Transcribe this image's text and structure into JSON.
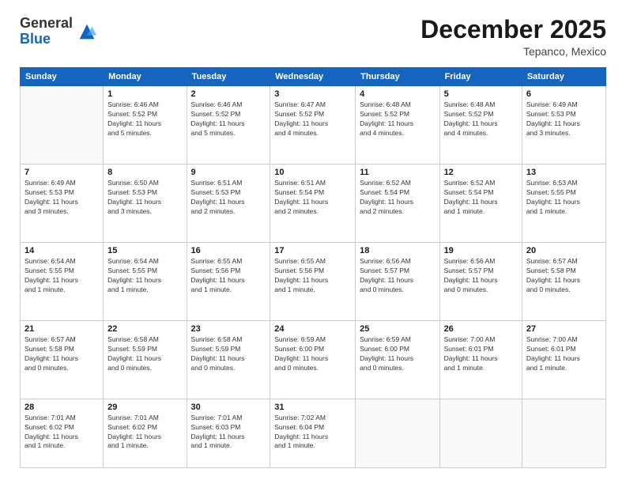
{
  "header": {
    "logo_general": "General",
    "logo_blue": "Blue",
    "month_title": "December 2025",
    "subtitle": "Tepanco, Mexico"
  },
  "calendar": {
    "days_of_week": [
      "Sunday",
      "Monday",
      "Tuesday",
      "Wednesday",
      "Thursday",
      "Friday",
      "Saturday"
    ],
    "weeks": [
      [
        {
          "num": "",
          "info": ""
        },
        {
          "num": "1",
          "info": "Sunrise: 6:46 AM\nSunset: 5:52 PM\nDaylight: 11 hours\nand 5 minutes."
        },
        {
          "num": "2",
          "info": "Sunrise: 6:46 AM\nSunset: 5:52 PM\nDaylight: 11 hours\nand 5 minutes."
        },
        {
          "num": "3",
          "info": "Sunrise: 6:47 AM\nSunset: 5:52 PM\nDaylight: 11 hours\nand 4 minutes."
        },
        {
          "num": "4",
          "info": "Sunrise: 6:48 AM\nSunset: 5:52 PM\nDaylight: 11 hours\nand 4 minutes."
        },
        {
          "num": "5",
          "info": "Sunrise: 6:48 AM\nSunset: 5:52 PM\nDaylight: 11 hours\nand 4 minutes."
        },
        {
          "num": "6",
          "info": "Sunrise: 6:49 AM\nSunset: 5:53 PM\nDaylight: 11 hours\nand 3 minutes."
        }
      ],
      [
        {
          "num": "7",
          "info": "Sunrise: 6:49 AM\nSunset: 5:53 PM\nDaylight: 11 hours\nand 3 minutes."
        },
        {
          "num": "8",
          "info": "Sunrise: 6:50 AM\nSunset: 5:53 PM\nDaylight: 11 hours\nand 3 minutes."
        },
        {
          "num": "9",
          "info": "Sunrise: 6:51 AM\nSunset: 5:53 PM\nDaylight: 11 hours\nand 2 minutes."
        },
        {
          "num": "10",
          "info": "Sunrise: 6:51 AM\nSunset: 5:54 PM\nDaylight: 11 hours\nand 2 minutes."
        },
        {
          "num": "11",
          "info": "Sunrise: 6:52 AM\nSunset: 5:54 PM\nDaylight: 11 hours\nand 2 minutes."
        },
        {
          "num": "12",
          "info": "Sunrise: 6:52 AM\nSunset: 5:54 PM\nDaylight: 11 hours\nand 1 minute."
        },
        {
          "num": "13",
          "info": "Sunrise: 6:53 AM\nSunset: 5:55 PM\nDaylight: 11 hours\nand 1 minute."
        }
      ],
      [
        {
          "num": "14",
          "info": "Sunrise: 6:54 AM\nSunset: 5:55 PM\nDaylight: 11 hours\nand 1 minute."
        },
        {
          "num": "15",
          "info": "Sunrise: 6:54 AM\nSunset: 5:55 PM\nDaylight: 11 hours\nand 1 minute."
        },
        {
          "num": "16",
          "info": "Sunrise: 6:55 AM\nSunset: 5:56 PM\nDaylight: 11 hours\nand 1 minute."
        },
        {
          "num": "17",
          "info": "Sunrise: 6:55 AM\nSunset: 5:56 PM\nDaylight: 11 hours\nand 1 minute."
        },
        {
          "num": "18",
          "info": "Sunrise: 6:56 AM\nSunset: 5:57 PM\nDaylight: 11 hours\nand 0 minutes."
        },
        {
          "num": "19",
          "info": "Sunrise: 6:56 AM\nSunset: 5:57 PM\nDaylight: 11 hours\nand 0 minutes."
        },
        {
          "num": "20",
          "info": "Sunrise: 6:57 AM\nSunset: 5:58 PM\nDaylight: 11 hours\nand 0 minutes."
        }
      ],
      [
        {
          "num": "21",
          "info": "Sunrise: 6:57 AM\nSunset: 5:58 PM\nDaylight: 11 hours\nand 0 minutes."
        },
        {
          "num": "22",
          "info": "Sunrise: 6:58 AM\nSunset: 5:59 PM\nDaylight: 11 hours\nand 0 minutes."
        },
        {
          "num": "23",
          "info": "Sunrise: 6:58 AM\nSunset: 5:59 PM\nDaylight: 11 hours\nand 0 minutes."
        },
        {
          "num": "24",
          "info": "Sunrise: 6:59 AM\nSunset: 6:00 PM\nDaylight: 11 hours\nand 0 minutes."
        },
        {
          "num": "25",
          "info": "Sunrise: 6:59 AM\nSunset: 6:00 PM\nDaylight: 11 hours\nand 0 minutes."
        },
        {
          "num": "26",
          "info": "Sunrise: 7:00 AM\nSunset: 6:01 PM\nDaylight: 11 hours\nand 1 minute."
        },
        {
          "num": "27",
          "info": "Sunrise: 7:00 AM\nSunset: 6:01 PM\nDaylight: 11 hours\nand 1 minute."
        }
      ],
      [
        {
          "num": "28",
          "info": "Sunrise: 7:01 AM\nSunset: 6:02 PM\nDaylight: 11 hours\nand 1 minute."
        },
        {
          "num": "29",
          "info": "Sunrise: 7:01 AM\nSunset: 6:02 PM\nDaylight: 11 hours\nand 1 minute."
        },
        {
          "num": "30",
          "info": "Sunrise: 7:01 AM\nSunset: 6:03 PM\nDaylight: 11 hours\nand 1 minute."
        },
        {
          "num": "31",
          "info": "Sunrise: 7:02 AM\nSunset: 6:04 PM\nDaylight: 11 hours\nand 1 minute."
        },
        {
          "num": "",
          "info": ""
        },
        {
          "num": "",
          "info": ""
        },
        {
          "num": "",
          "info": ""
        }
      ]
    ]
  }
}
